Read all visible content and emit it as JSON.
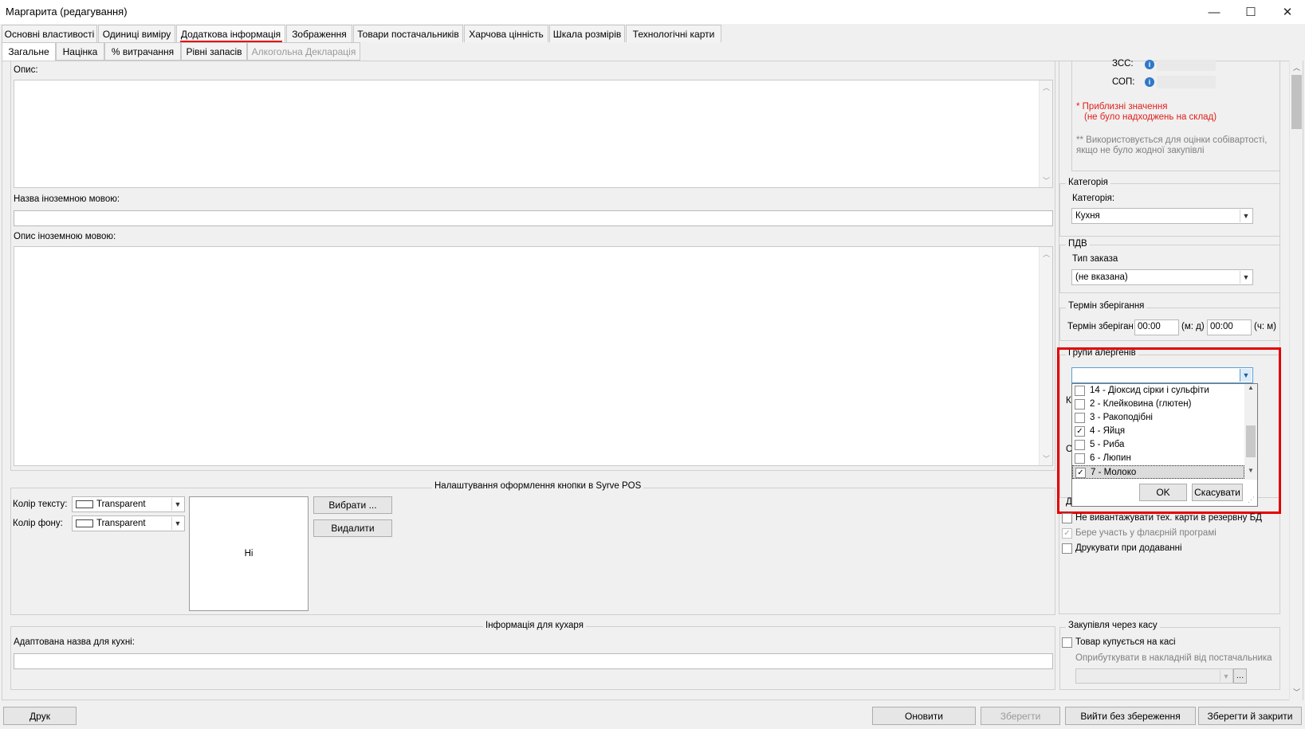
{
  "window": {
    "title": "Маргарита (редагування)",
    "minimize_glyph": "—",
    "maximize_glyph": "☐",
    "close_glyph": "✕"
  },
  "tabs_main": [
    "Основні властивості",
    "Одиниці виміру",
    "Додаткова інформація",
    "Зображення",
    "Товари постачальників",
    "Харчова цінність",
    "Шкала розмірів",
    "Технологічні карти"
  ],
  "tabs_main_active": "Додаткова інформація",
  "tabs_sub": [
    "Загальне",
    "Націнка",
    "% витрачання",
    "Рівні запасів",
    "Алкогольна Декларація"
  ],
  "tabs_sub_active": "Загальне",
  "left": {
    "description_label": "Опис:",
    "foreign_name_label": "Назва іноземною мовою:",
    "foreign_desc_label": "Опис іноземною мовою:",
    "pos_group_title": "Налаштування оформлення кнопки в Syrve POS",
    "text_color_label": "Колір тексту:",
    "text_color_value": "Transparent",
    "bg_color_label": "Колір фону:",
    "bg_color_value": "Transparent",
    "select_btn": "Вибрати ...",
    "delete_btn": "Видалити",
    "preview_text": "Hi",
    "chef_group_title": "Інформація для кухаря",
    "kitchen_name_label": "Адаптована назва для кухні:"
  },
  "right": {
    "zss_label": "ЗСС:",
    "sop_label": "СОП:",
    "approx_note_1": "* Приблизні значення",
    "approx_note_2": "(не було надходжень на склад)",
    "usage_note_1": "** Використовується для оцінки собівартості,",
    "usage_note_2": "якщо не було жодної закупівлі",
    "category_group": "Категорія",
    "category_label": "Категорія:",
    "category_value": "Кухня",
    "vat_group": "ПДВ",
    "order_type_label": "Тип заказа",
    "order_type_value": "(не вказана)",
    "storage_group": "Термін зберігання",
    "storage_label": "Термін зберігання",
    "storage_value_1": "00:00",
    "storage_unit_1": "(м: д)",
    "storage_value_2": "00:00",
    "storage_unit_2": "(ч: м)",
    "allergen_group": "Групи алергенів",
    "allergen_items": [
      {
        "label": "14 - Діоксид сірки і сульфіти",
        "checked": false
      },
      {
        "label": "2 - Клейковина (глютен)",
        "checked": false
      },
      {
        "label": "3 - Ракоподібні",
        "checked": false
      },
      {
        "label": "4 - Яйця",
        "checked": true
      },
      {
        "label": "5 - Риба",
        "checked": false
      },
      {
        "label": "6 - Люпин",
        "checked": false
      },
      {
        "label": "7 - Молоко",
        "checked": true
      }
    ],
    "allergen_ok": "OK",
    "allergen_cancel": "Скасувати",
    "hidden_group_letter_1": "К",
    "hidden_group_letter_2": "С",
    "hidden_group_letter_3": "Д",
    "check_no_export": "Не вивантажувати тех. карти в резервну БД",
    "check_flyer": "Бере участь у флаєрній програмі",
    "check_print": "Друкувати при додаванні",
    "purchase_group": "Закупівля через касу",
    "check_purchased": "Товар купується на касі",
    "post_in_invoice": "Оприбуткувати в накладній від постачальника"
  },
  "footer": {
    "print_btn": "Друк",
    "refresh_btn": "Оновити",
    "save_btn": "Зберегти",
    "exit_btn": "Вийти без збереження",
    "save_close_btn": "Зберегти й закрити"
  },
  "colors": {
    "highlight_red": "#e50000",
    "info_blue": "#2f78c8",
    "note_red": "#e0201a"
  }
}
